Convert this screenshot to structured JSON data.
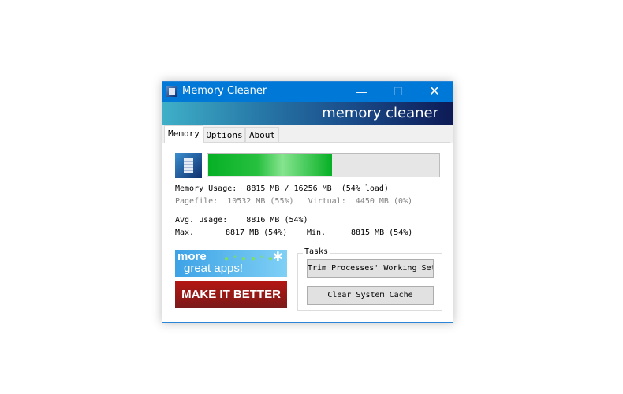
{
  "window": {
    "title": "Memory Cleaner",
    "controls": {
      "minimize": "—",
      "maximize": "☐",
      "close": "✕"
    },
    "banner_text": "memory cleaner"
  },
  "tabs": [
    {
      "label": "Memory",
      "active": true
    },
    {
      "label": "Options",
      "active": false
    },
    {
      "label": "About",
      "active": false
    }
  ],
  "memory": {
    "usage_percent": 54,
    "usage_line": "Memory Usage:  8815 MB / 16256 MB  (54% load)",
    "pagefile_line": "Pagefile:  10532 MB (55%)   Virtual:  4450 MB (0%)",
    "avg_line": "Avg. usage:    8816 MB (54%)",
    "max_label": "Max.",
    "max_value": "8817 MB (54%)",
    "min_label": "Min.",
    "min_value": "8815 MB (54%)"
  },
  "ads": {
    "more_apps_line1": "more",
    "more_apps_line2": "great apps!",
    "make_it_better": "MAKE IT BETTER"
  },
  "tasks": {
    "group_label": "Tasks",
    "trim_button": "Trim Processes' Working Set",
    "clear_cache_button": "Clear System Cache"
  }
}
